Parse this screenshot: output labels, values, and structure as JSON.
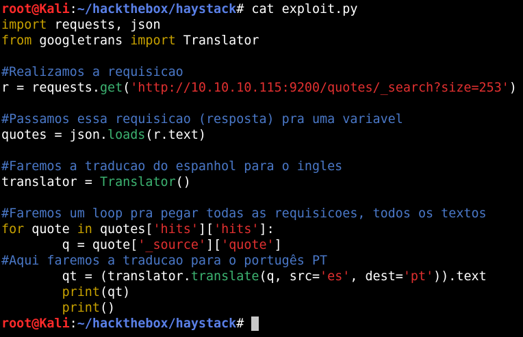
{
  "colors": {
    "background": "#000000",
    "user_host": "#ff2a2a",
    "path": "#5a80e8",
    "keyword": "#c8a200",
    "function": "#3cb371",
    "string": "#e23030",
    "comment": "#4a78c8",
    "plain": "#ffffff",
    "cursor": "#c8c8c8"
  },
  "terminal": {
    "lines": [
      [
        {
          "text": "root@Kali",
          "color": "#ff2a2a",
          "bold": true
        },
        {
          "text": ":",
          "color": "#ffffff"
        },
        {
          "text": "~/hackthebox/haystack",
          "color": "#5a80e8",
          "bold": true
        },
        {
          "text": "# cat exploit.py",
          "color": "#ffffff"
        }
      ],
      [
        {
          "text": "import",
          "color": "#c8a200"
        },
        {
          "text": " requests, json",
          "color": "#ffffff"
        }
      ],
      [
        {
          "text": "from",
          "color": "#c8a200"
        },
        {
          "text": " googletrans ",
          "color": "#ffffff"
        },
        {
          "text": "import",
          "color": "#c8a200"
        },
        {
          "text": " Translator",
          "color": "#ffffff"
        }
      ],
      [],
      [
        {
          "text": "#Realizamos a requisicao",
          "color": "#4a78c8"
        }
      ],
      [
        {
          "text": "r = requests.",
          "color": "#ffffff"
        },
        {
          "text": "get",
          "color": "#3cb371"
        },
        {
          "text": "(",
          "color": "#ffffff"
        },
        {
          "text": "'http://10.10.10.115:9200/quotes/_search?size=253'",
          "color": "#e23030"
        },
        {
          "text": ")",
          "color": "#ffffff"
        }
      ],
      [],
      [
        {
          "text": "#Passamos essa requisicao (resposta) pra uma variavel",
          "color": "#4a78c8"
        }
      ],
      [
        {
          "text": "quotes = json.",
          "color": "#ffffff"
        },
        {
          "text": "loads",
          "color": "#3cb371"
        },
        {
          "text": "(r.text)",
          "color": "#ffffff"
        }
      ],
      [],
      [
        {
          "text": "#Faremos a traducao do espanhol para o ingles",
          "color": "#4a78c8"
        }
      ],
      [
        {
          "text": "translator = ",
          "color": "#ffffff"
        },
        {
          "text": "Translator",
          "color": "#3cb371"
        },
        {
          "text": "()",
          "color": "#ffffff"
        }
      ],
      [],
      [
        {
          "text": "#Faremos um loop pra pegar todas as requisicoes, todos os textos",
          "color": "#4a78c8"
        }
      ],
      [
        {
          "text": "for",
          "color": "#c8a200"
        },
        {
          "text": " quote ",
          "color": "#ffffff"
        },
        {
          "text": "in",
          "color": "#c8a200"
        },
        {
          "text": " quotes[",
          "color": "#ffffff"
        },
        {
          "text": "'hits'",
          "color": "#e23030"
        },
        {
          "text": "][",
          "color": "#ffffff"
        },
        {
          "text": "'hits'",
          "color": "#e23030"
        },
        {
          "text": "]:",
          "color": "#ffffff"
        }
      ],
      [
        {
          "text": "        q = quote[",
          "color": "#ffffff"
        },
        {
          "text": "'_source'",
          "color": "#e23030"
        },
        {
          "text": "][",
          "color": "#ffffff"
        },
        {
          "text": "'quote'",
          "color": "#e23030"
        },
        {
          "text": "]",
          "color": "#ffffff"
        }
      ],
      [
        {
          "text": "#Aqui faremos a traducao para o portugês PT",
          "color": "#4a78c8"
        }
      ],
      [
        {
          "text": "        qt = (translator.",
          "color": "#ffffff"
        },
        {
          "text": "translate",
          "color": "#3cb371"
        },
        {
          "text": "(q, src=",
          "color": "#ffffff"
        },
        {
          "text": "'es'",
          "color": "#e23030"
        },
        {
          "text": ", dest=",
          "color": "#ffffff"
        },
        {
          "text": "'pt'",
          "color": "#e23030"
        },
        {
          "text": ")).text",
          "color": "#ffffff"
        }
      ],
      [
        {
          "text": "        ",
          "color": "#ffffff"
        },
        {
          "text": "print",
          "color": "#c8a200"
        },
        {
          "text": "(qt)",
          "color": "#ffffff"
        }
      ],
      [
        {
          "text": "        ",
          "color": "#ffffff"
        },
        {
          "text": "print",
          "color": "#c8a200"
        },
        {
          "text": "()",
          "color": "#ffffff"
        }
      ],
      [
        {
          "text": "root@Kali",
          "color": "#ff2a2a",
          "bold": true
        },
        {
          "text": ":",
          "color": "#ffffff"
        },
        {
          "text": "~/hackthebox/haystack",
          "color": "#5a80e8",
          "bold": true
        },
        {
          "text": "# ",
          "color": "#ffffff"
        }
      ]
    ],
    "cursor_line": 20
  }
}
